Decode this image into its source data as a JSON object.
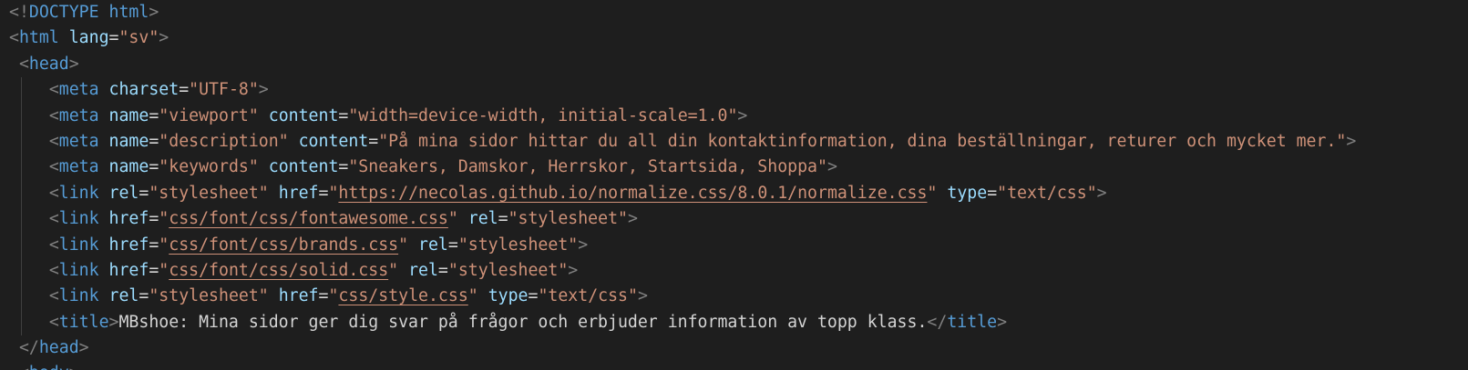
{
  "editor": {
    "language": "html",
    "lines": [
      {
        "indent": 0,
        "tokens": [
          [
            "bracket",
            "<!"
          ],
          [
            "tag",
            "DOCTYPE"
          ],
          [
            "text",
            " "
          ],
          [
            "tag",
            "html"
          ],
          [
            "bracket",
            ">"
          ]
        ]
      },
      {
        "indent": 0,
        "tokens": [
          [
            "bracket",
            "<"
          ],
          [
            "tag",
            "html"
          ],
          [
            "text",
            " "
          ],
          [
            "attr",
            "lang"
          ],
          [
            "eq",
            "="
          ],
          [
            "str",
            "\"sv\""
          ],
          [
            "bracket",
            ">"
          ]
        ]
      },
      {
        "indent": 1,
        "tokens": [
          [
            "bracket",
            "<"
          ],
          [
            "tag",
            "head"
          ],
          [
            "bracket",
            ">"
          ]
        ]
      },
      {
        "indent": 4,
        "tokens": [
          [
            "bracket",
            "<"
          ],
          [
            "tag",
            "meta"
          ],
          [
            "text",
            " "
          ],
          [
            "attr",
            "charset"
          ],
          [
            "eq",
            "="
          ],
          [
            "str",
            "\"UTF-8\""
          ],
          [
            "bracket",
            ">"
          ]
        ]
      },
      {
        "indent": 4,
        "tokens": [
          [
            "bracket",
            "<"
          ],
          [
            "tag",
            "meta"
          ],
          [
            "text",
            " "
          ],
          [
            "attr",
            "name"
          ],
          [
            "eq",
            "="
          ],
          [
            "str",
            "\"viewport\""
          ],
          [
            "text",
            " "
          ],
          [
            "attr",
            "content"
          ],
          [
            "eq",
            "="
          ],
          [
            "str",
            "\"width=device-width, initial-scale=1.0\""
          ],
          [
            "bracket",
            ">"
          ]
        ]
      },
      {
        "indent": 4,
        "tokens": [
          [
            "bracket",
            "<"
          ],
          [
            "tag",
            "meta"
          ],
          [
            "text",
            " "
          ],
          [
            "attr",
            "name"
          ],
          [
            "eq",
            "="
          ],
          [
            "str",
            "\"description\""
          ],
          [
            "text",
            " "
          ],
          [
            "attr",
            "content"
          ],
          [
            "eq",
            "="
          ],
          [
            "str",
            "\"På mina sidor hittar du all din kontaktinformation, dina beställningar, returer och mycket mer.\""
          ],
          [
            "bracket",
            ">"
          ]
        ]
      },
      {
        "indent": 4,
        "tokens": [
          [
            "bracket",
            "<"
          ],
          [
            "tag",
            "meta"
          ],
          [
            "text",
            " "
          ],
          [
            "attr",
            "name"
          ],
          [
            "eq",
            "="
          ],
          [
            "str",
            "\"keywords\""
          ],
          [
            "text",
            " "
          ],
          [
            "attr",
            "content"
          ],
          [
            "eq",
            "="
          ],
          [
            "str",
            "\"Sneakers, Damskor, Herrskor, Startsida, Shoppa\""
          ],
          [
            "bracket",
            ">"
          ]
        ]
      },
      {
        "indent": 4,
        "tokens": [
          [
            "bracket",
            "<"
          ],
          [
            "tag",
            "link"
          ],
          [
            "text",
            " "
          ],
          [
            "attr",
            "rel"
          ],
          [
            "eq",
            "="
          ],
          [
            "str",
            "\"stylesheet\""
          ],
          [
            "text",
            " "
          ],
          [
            "attr",
            "href"
          ],
          [
            "eq",
            "="
          ],
          [
            "str",
            "\""
          ],
          [
            "link",
            "https://necolas.github.io/normalize.css/8.0.1/normalize.css"
          ],
          [
            "str",
            "\""
          ],
          [
            "text",
            " "
          ],
          [
            "attr",
            "type"
          ],
          [
            "eq",
            "="
          ],
          [
            "str",
            "\"text/css\""
          ],
          [
            "bracket",
            ">"
          ]
        ]
      },
      {
        "indent": 4,
        "tokens": [
          [
            "bracket",
            "<"
          ],
          [
            "tag",
            "link"
          ],
          [
            "text",
            " "
          ],
          [
            "attr",
            "href"
          ],
          [
            "eq",
            "="
          ],
          [
            "str",
            "\""
          ],
          [
            "link",
            "css/font/css/fontawesome.css"
          ],
          [
            "str",
            "\""
          ],
          [
            "text",
            " "
          ],
          [
            "attr",
            "rel"
          ],
          [
            "eq",
            "="
          ],
          [
            "str",
            "\"stylesheet\""
          ],
          [
            "bracket",
            ">"
          ]
        ]
      },
      {
        "indent": 4,
        "tokens": [
          [
            "bracket",
            "<"
          ],
          [
            "tag",
            "link"
          ],
          [
            "text",
            " "
          ],
          [
            "attr",
            "href"
          ],
          [
            "eq",
            "="
          ],
          [
            "str",
            "\""
          ],
          [
            "link",
            "css/font/css/brands.css"
          ],
          [
            "str",
            "\""
          ],
          [
            "text",
            " "
          ],
          [
            "attr",
            "rel"
          ],
          [
            "eq",
            "="
          ],
          [
            "str",
            "\"stylesheet\""
          ],
          [
            "bracket",
            ">"
          ]
        ]
      },
      {
        "indent": 4,
        "tokens": [
          [
            "bracket",
            "<"
          ],
          [
            "tag",
            "link"
          ],
          [
            "text",
            " "
          ],
          [
            "attr",
            "href"
          ],
          [
            "eq",
            "="
          ],
          [
            "str",
            "\""
          ],
          [
            "link",
            "css/font/css/solid.css"
          ],
          [
            "str",
            "\""
          ],
          [
            "text",
            " "
          ],
          [
            "attr",
            "rel"
          ],
          [
            "eq",
            "="
          ],
          [
            "str",
            "\"stylesheet\""
          ],
          [
            "bracket",
            ">"
          ]
        ]
      },
      {
        "indent": 4,
        "tokens": [
          [
            "bracket",
            "<"
          ],
          [
            "tag",
            "link"
          ],
          [
            "text",
            " "
          ],
          [
            "attr",
            "rel"
          ],
          [
            "eq",
            "="
          ],
          [
            "str",
            "\"stylesheet\""
          ],
          [
            "text",
            " "
          ],
          [
            "attr",
            "href"
          ],
          [
            "eq",
            "="
          ],
          [
            "str",
            "\""
          ],
          [
            "link",
            "css/style.css"
          ],
          [
            "str",
            "\""
          ],
          [
            "text",
            " "
          ],
          [
            "attr",
            "type"
          ],
          [
            "eq",
            "="
          ],
          [
            "str",
            "\"text/css\""
          ],
          [
            "bracket",
            ">"
          ]
        ]
      },
      {
        "indent": 4,
        "tokens": [
          [
            "bracket",
            "<"
          ],
          [
            "tag",
            "title"
          ],
          [
            "bracket",
            ">"
          ],
          [
            "text",
            "MBshoe: Mina sidor ger dig svar på frågor och erbjuder information av topp klass."
          ],
          [
            "bracket",
            "</"
          ],
          [
            "tag",
            "title"
          ],
          [
            "bracket",
            ">"
          ]
        ]
      },
      {
        "indent": 1,
        "tokens": [
          [
            "bracket",
            "</"
          ],
          [
            "tag",
            "head"
          ],
          [
            "bracket",
            ">"
          ]
        ]
      },
      {
        "indent": 1,
        "tokens": [
          [
            "bracket",
            "<"
          ],
          [
            "tag",
            "body"
          ],
          [
            "bracket",
            ">"
          ]
        ]
      }
    ]
  }
}
